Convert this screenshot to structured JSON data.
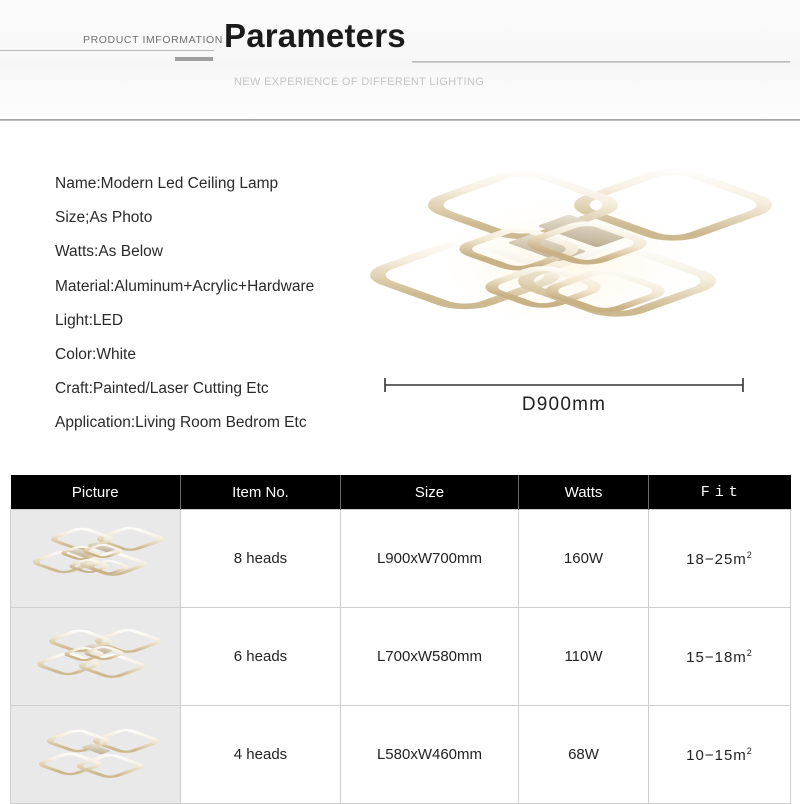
{
  "header": {
    "eyebrow": "PRODUCT  IMFORMATION",
    "title": "Parameters",
    "subtitle": "NEW EXPERIENCE OF DIFFERENT LIGHTING"
  },
  "specs": [
    "Name:Modern Led Ceiling Lamp",
    "Size;As Photo",
    "Watts:As Below",
    "Material:Aluminum+Acrylic+Hardware",
    "Light:LED",
    "Color:White",
    "Craft:Painted/Laser Cutting Etc",
    "Application:Living Room Bedrom Etc"
  ],
  "product": {
    "dimension_label": "D900mm",
    "heads": 8
  },
  "table": {
    "columns": [
      "Picture",
      "Item No.",
      "Size",
      "Watts",
      "Fit"
    ],
    "rows": [
      {
        "picture": "lamp-8-heads-thumbnail",
        "item_no": "8 heads",
        "size": "L900xW700mm",
        "watts": "160W",
        "fit_range": "18−25m",
        "fit_unit": "2",
        "rings": 8
      },
      {
        "picture": "lamp-6-heads-thumbnail",
        "item_no": "6 heads",
        "size": "L700xW580mm",
        "watts": "110W",
        "fit_range": "15−18m",
        "fit_unit": "2",
        "rings": 6
      },
      {
        "picture": "lamp-4-heads-thumbnail",
        "item_no": "4 heads",
        "size": "L580xW460mm",
        "watts": "68W",
        "fit_range": "10−15m",
        "fit_unit": "2",
        "rings": 4
      }
    ]
  },
  "colors": {
    "header_background": "#f8f8f8",
    "title_text": "#1b1b1b",
    "subtitle_text": "#c5c5c5",
    "table_header_background": "#000000",
    "table_header_text": "#ffffff",
    "thumbnail_background": "#e9e9e9",
    "lamp_frame": "#d9c9a8",
    "body_background": "#ffffff"
  }
}
